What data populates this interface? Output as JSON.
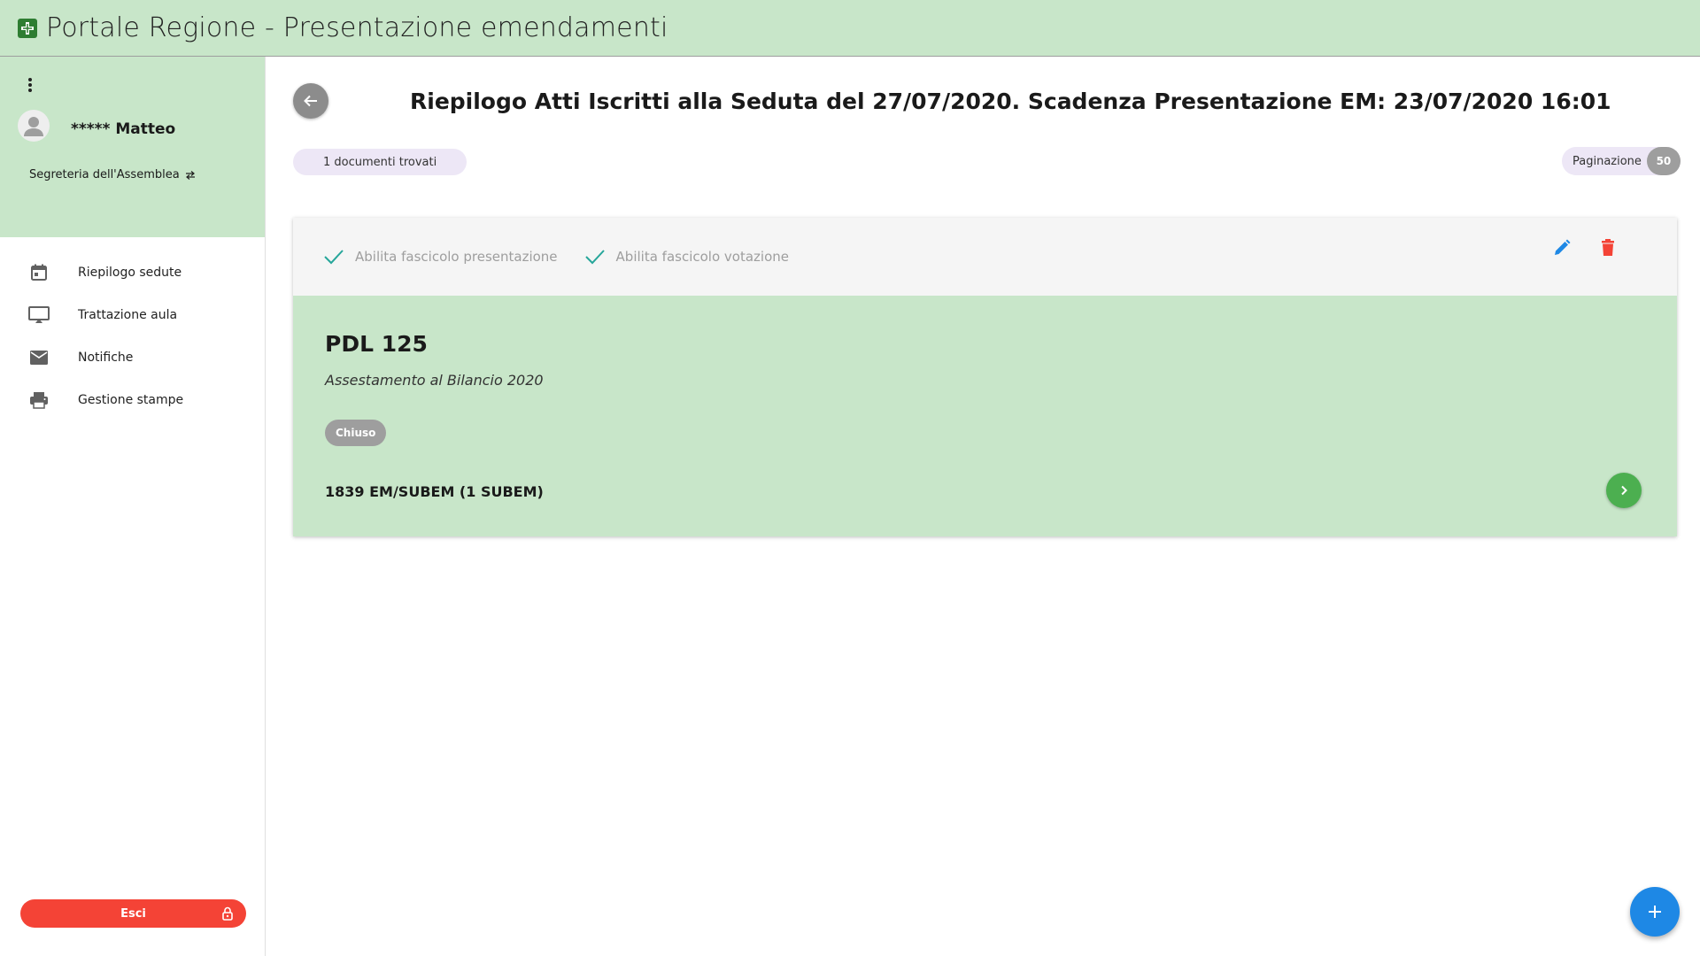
{
  "app": {
    "title": "Portale Regione - Presentazione emendamenti",
    "logo_icon": "regione-logo-icon"
  },
  "sidebar": {
    "menu_icon": "more-vert-icon",
    "user": {
      "name": "***** Matteo",
      "avatar_icon": "account-icon"
    },
    "role": {
      "label": "Segreteria dell'Assemblea",
      "icon": "swap-icon"
    },
    "items": [
      {
        "label": "Riepilogo sedute",
        "icon": "calendar-icon"
      },
      {
        "label": "Trattazione aula",
        "icon": "monitor-icon"
      },
      {
        "label": "Notifiche",
        "icon": "mail-icon"
      },
      {
        "label": "Gestione stampe",
        "icon": "printer-icon"
      }
    ],
    "logout": {
      "label": "Esci",
      "icon": "lock-icon",
      "color": "#f44336"
    }
  },
  "main": {
    "back_icon": "arrow-left-icon",
    "title": "Riepilogo Atti Iscritti alla Seduta del 27/07/2020. Scadenza Presentazione EM: 23/07/2020 16:01",
    "doc_count": "1 documenti trovati",
    "pagination": {
      "label": "Paginazione",
      "value": "50"
    },
    "card": {
      "checks": [
        {
          "label": "Abilita fascicolo presentazione",
          "checked": true
        },
        {
          "label": "Abilita fascicolo votazione",
          "checked": true
        }
      ],
      "edit_icon": "pencil-icon",
      "delete_icon": "trash-icon",
      "title": "PDL 125",
      "subtitle": "Assestamento al Bilancio 2020",
      "status": "Chiuso",
      "em_count": "1839 EM/SUBEM (1 SUBEM)",
      "open_icon": "chevron-right-icon",
      "bg_color": "#c8e6c9"
    },
    "fab_icon": "plus-icon"
  },
  "colors": {
    "accent_green": "#c8e6c9",
    "danger": "#f44336",
    "primary": "#1e88e5",
    "success": "#4caf50"
  }
}
